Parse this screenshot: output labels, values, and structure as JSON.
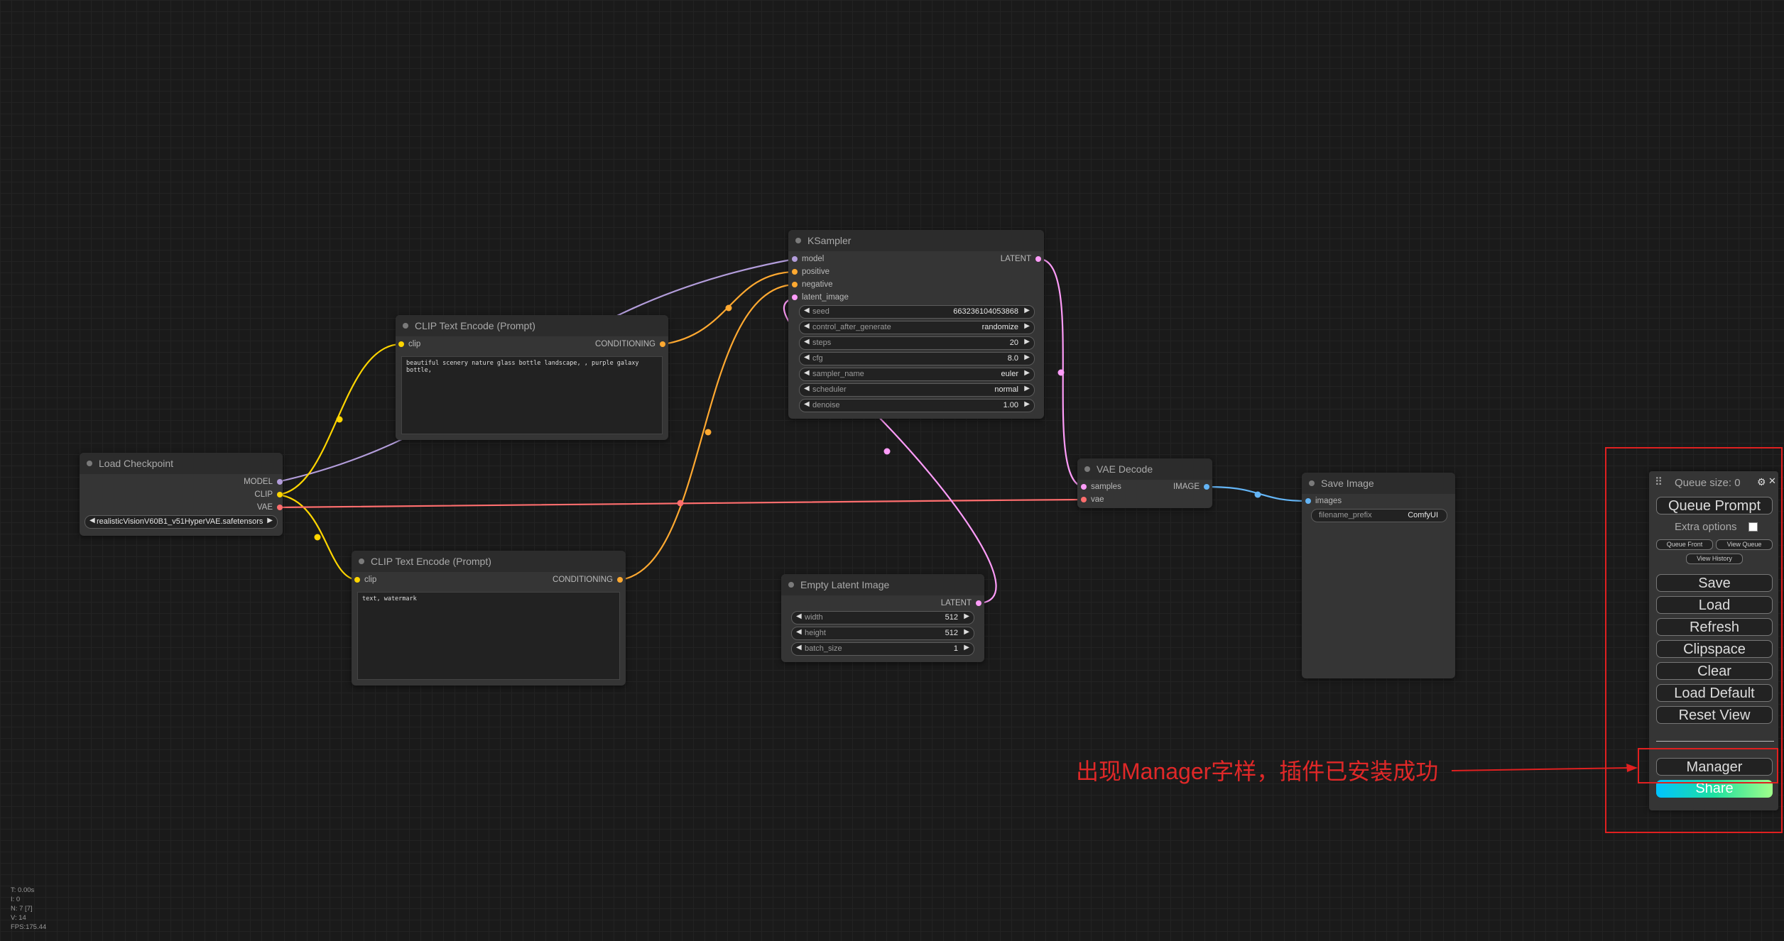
{
  "colors": {
    "canvas_bg": "#1a1a1a",
    "node_bg": "#353535",
    "model_link": "#b39ddb",
    "clip_link": "#ffd500",
    "conditioning_link": "#ffa931",
    "latent_link": "#ff9cf9",
    "vae_link": "#ff6e6e",
    "image_link": "#64b5f6",
    "annotation_red": "#e02020"
  },
  "nodes": {
    "load_checkpoint": {
      "title": "Load Checkpoint",
      "outputs": [
        "MODEL",
        "CLIP",
        "VAE"
      ],
      "ckpt_value": "realisticVisionV60B1_v51HyperVAE.safetensors"
    },
    "clip_pos": {
      "title": "CLIP Text Encode (Prompt)",
      "input": "clip",
      "output": "CONDITIONING",
      "text": "beautiful scenery nature glass bottle landscape, , purple galaxy bottle,"
    },
    "clip_neg": {
      "title": "CLIP Text Encode (Prompt)",
      "input": "clip",
      "output": "CONDITIONING",
      "text": "text, watermark"
    },
    "ksampler": {
      "title": "KSampler",
      "inputs": [
        "model",
        "positive",
        "negative",
        "latent_image"
      ],
      "output": "LATENT",
      "widgets": [
        {
          "name": "seed",
          "value": "663236104053868"
        },
        {
          "name": "control_after_generate",
          "value": "randomize"
        },
        {
          "name": "steps",
          "value": "20"
        },
        {
          "name": "cfg",
          "value": "8.0"
        },
        {
          "name": "sampler_name",
          "value": "euler"
        },
        {
          "name": "scheduler",
          "value": "normal"
        },
        {
          "name": "denoise",
          "value": "1.00"
        }
      ]
    },
    "empty_latent": {
      "title": "Empty Latent Image",
      "output": "LATENT",
      "widgets": [
        {
          "name": "width",
          "value": "512"
        },
        {
          "name": "height",
          "value": "512"
        },
        {
          "name": "batch_size",
          "value": "1"
        }
      ]
    },
    "vae_decode": {
      "title": "VAE Decode",
      "inputs": [
        "samples",
        "vae"
      ],
      "output": "IMAGE"
    },
    "save_image": {
      "title": "Save Image",
      "input": "images",
      "widget": {
        "name": "filename_prefix",
        "value": "ComfyUI"
      }
    }
  },
  "menu": {
    "drag_handle": "⠿",
    "queue_size": "Queue size: 0",
    "settings_icon": "gear-icon",
    "close_glyph": "✕",
    "queue_prompt": "Queue Prompt",
    "extra_options": "Extra options",
    "queue_front": "Queue Front",
    "view_queue": "View Queue",
    "view_history": "View History",
    "save": "Save",
    "load": "Load",
    "refresh": "Refresh",
    "clipspace": "Clipspace",
    "clear": "Clear",
    "load_default": "Load Default",
    "reset_view": "Reset View",
    "manager": "Manager",
    "share": "Share"
  },
  "annotation": {
    "text": "出现Manager字样，插件已安装成功"
  },
  "stats": {
    "t": "T: 0.00s",
    "i": "I: 0",
    "n": "N: 7 [7]",
    "v": "V: 14",
    "fps": "FPS:175.44"
  }
}
